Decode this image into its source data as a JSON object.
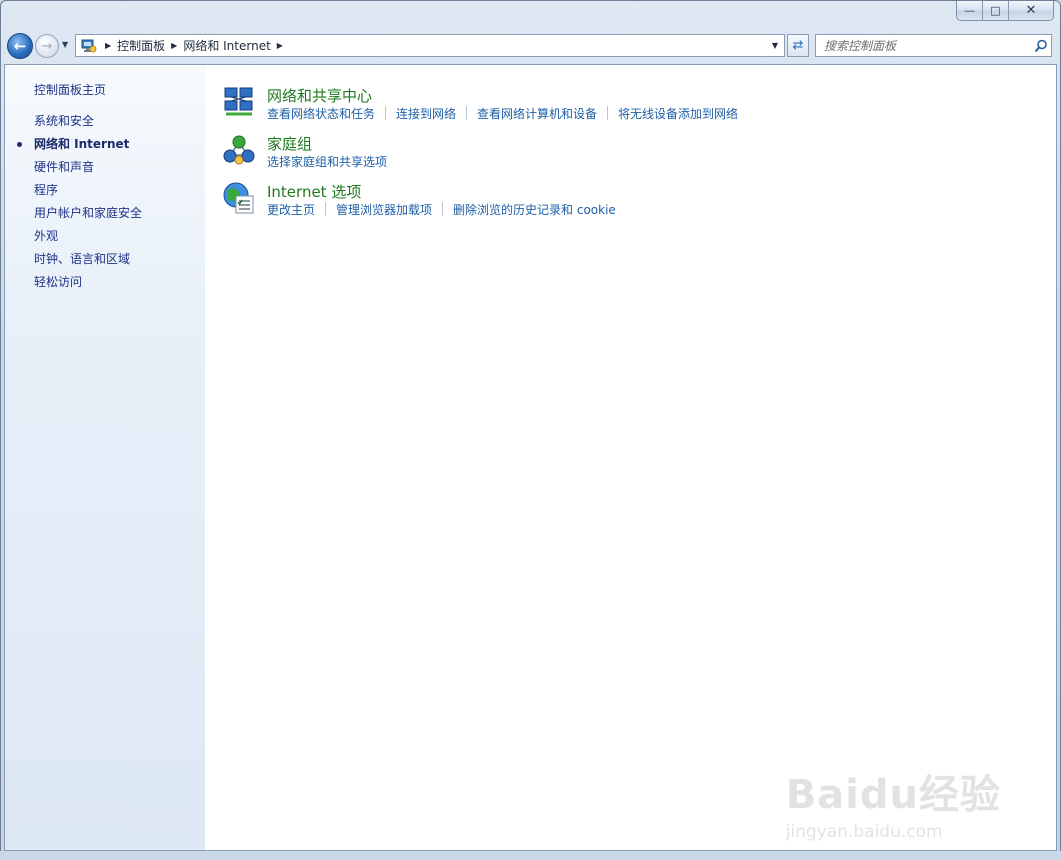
{
  "window": {
    "minimize_glyph": "—",
    "maximize_glyph": "□",
    "close_glyph": "✕"
  },
  "nav": {
    "back_glyph": "←",
    "forward_glyph": "→",
    "recent_glyph": "▼",
    "breadcrumb": [
      "控制面板",
      "网络和 Internet"
    ],
    "crumb_sep": "▶",
    "dropdown_glyph": "▼",
    "refresh_glyph": "⇄"
  },
  "search": {
    "placeholder": "搜索控制面板"
  },
  "sidebar": {
    "home": "控制面板主页",
    "items": [
      {
        "label": "系统和安全",
        "active": false
      },
      {
        "label": "网络和 Internet",
        "active": true
      },
      {
        "label": "硬件和声音",
        "active": false
      },
      {
        "label": "程序",
        "active": false
      },
      {
        "label": "用户帐户和家庭安全",
        "active": false
      },
      {
        "label": "外观",
        "active": false
      },
      {
        "label": "时钟、语言和区域",
        "active": false
      },
      {
        "label": "轻松访问",
        "active": false
      }
    ]
  },
  "categories": [
    {
      "title": "网络和共享中心",
      "icon": "network-sharing-center-icon",
      "links": [
        "查看网络状态和任务",
        "连接到网络",
        "查看网络计算机和设备",
        "将无线设备添加到网络"
      ]
    },
    {
      "title": "家庭组",
      "icon": "homegroup-icon",
      "links": [
        "选择家庭组和共享选项"
      ]
    },
    {
      "title": "Internet 选项",
      "icon": "internet-options-icon",
      "links": [
        "更改主页",
        "管理浏览器加载项",
        "删除浏览的历史记录和 cookie"
      ]
    }
  ],
  "watermark": {
    "logo": "Baidu经验",
    "url": "jingyan.baidu.com"
  },
  "colors": {
    "link": "#1f5fa6",
    "category_title": "#1e7a1e",
    "sidebar_link": "#1e3287"
  }
}
